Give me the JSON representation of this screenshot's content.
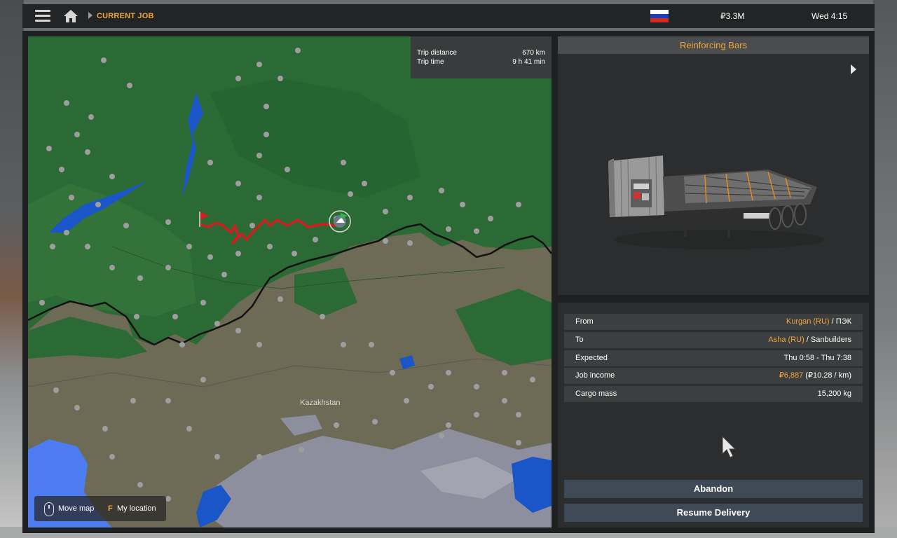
{
  "topbar": {
    "breadcrumb": "CURRENT JOB",
    "money": "₽3.3M",
    "clock": "Wed 4:15",
    "flag_colors": [
      "#ffffff",
      "#1c3fb8",
      "#d52b1e"
    ]
  },
  "map": {
    "trip": {
      "distance_label": "Trip distance",
      "distance_value": "670 km",
      "time_label": "Trip time",
      "time_value": "9 h 41 min"
    },
    "region_label": "Kazakhstan",
    "hints": {
      "move_label": "Move map",
      "location_key": "F",
      "location_label": "My location"
    },
    "colors": {
      "forest": "#2b6a34",
      "land": "#6d6a55",
      "water": "#1a56c8",
      "route": "#d21e1e"
    }
  },
  "cargo": {
    "title": "Reinforcing Bars"
  },
  "details": {
    "from_label": "From",
    "from_city": "Kurgan (RU)",
    "from_company": " / ПЭК",
    "to_label": "To",
    "to_city": "Asha (RU)",
    "to_company": " / Sanbuilders",
    "expected_label": "Expected",
    "expected_value": "Thu 0:58 - Thu 7:38",
    "income_label": "Job income",
    "income_value": "₽6,887",
    "income_rate": " (₽10.28 / km)",
    "mass_label": "Cargo mass",
    "mass_value": "15,200 kg"
  },
  "buttons": {
    "abandon": "Abandon",
    "resume": "Resume Delivery"
  }
}
